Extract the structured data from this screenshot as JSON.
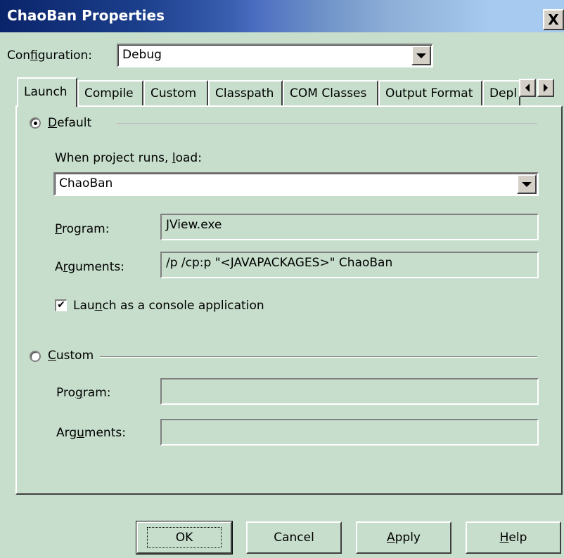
{
  "window": {
    "title": "ChaoBan Properties",
    "close_glyph": "X"
  },
  "configuration": {
    "label_pre": "Con",
    "label_mnemonic": "f",
    "label_post": "iguration:",
    "value": "Debug"
  },
  "tabs": [
    {
      "label": "Launch"
    },
    {
      "label": "Compile"
    },
    {
      "label": "Custom"
    },
    {
      "label": "Classpath"
    },
    {
      "label": "COM Classes"
    },
    {
      "label": "Output Format"
    },
    {
      "label": "Depl"
    }
  ],
  "launch": {
    "default_radio": {
      "mnemonic": "D",
      "rest": "efault",
      "selected": true
    },
    "when_runs": {
      "pre": "When project runs, ",
      "mnemonic": "l",
      "post": "oad:"
    },
    "load_value": "ChaoBan",
    "program": {
      "mnemonic": "P",
      "rest": "rogram:",
      "value": "JView.exe"
    },
    "arguments": {
      "pre": "A",
      "mnemonic": "r",
      "post": "guments:",
      "value": "/p /cp:p \"<JAVAPACKAGES>\" ChaoBan"
    },
    "console_checkbox": {
      "pre": "Lau",
      "mnemonic": "n",
      "post": "ch as a console application",
      "checked": true
    },
    "custom_radio": {
      "mnemonic": "C",
      "rest": "ustom",
      "selected": false
    },
    "custom_program": {
      "pre": "Pro",
      "mnemonic": "g",
      "post": "ram:",
      "value": ""
    },
    "custom_arguments": {
      "pre": "Arg",
      "mnemonic": "u",
      "post": "ments:",
      "value": ""
    }
  },
  "buttons": {
    "ok": "OK",
    "cancel": "Cancel",
    "apply": {
      "mnemonic": "A",
      "rest": "pply"
    },
    "help": {
      "mnemonic": "H",
      "rest": "elp"
    }
  },
  "colors": {
    "dialog_bg": "#c6decb",
    "title_start": "#0a246a",
    "title_end": "#a6caf0"
  }
}
